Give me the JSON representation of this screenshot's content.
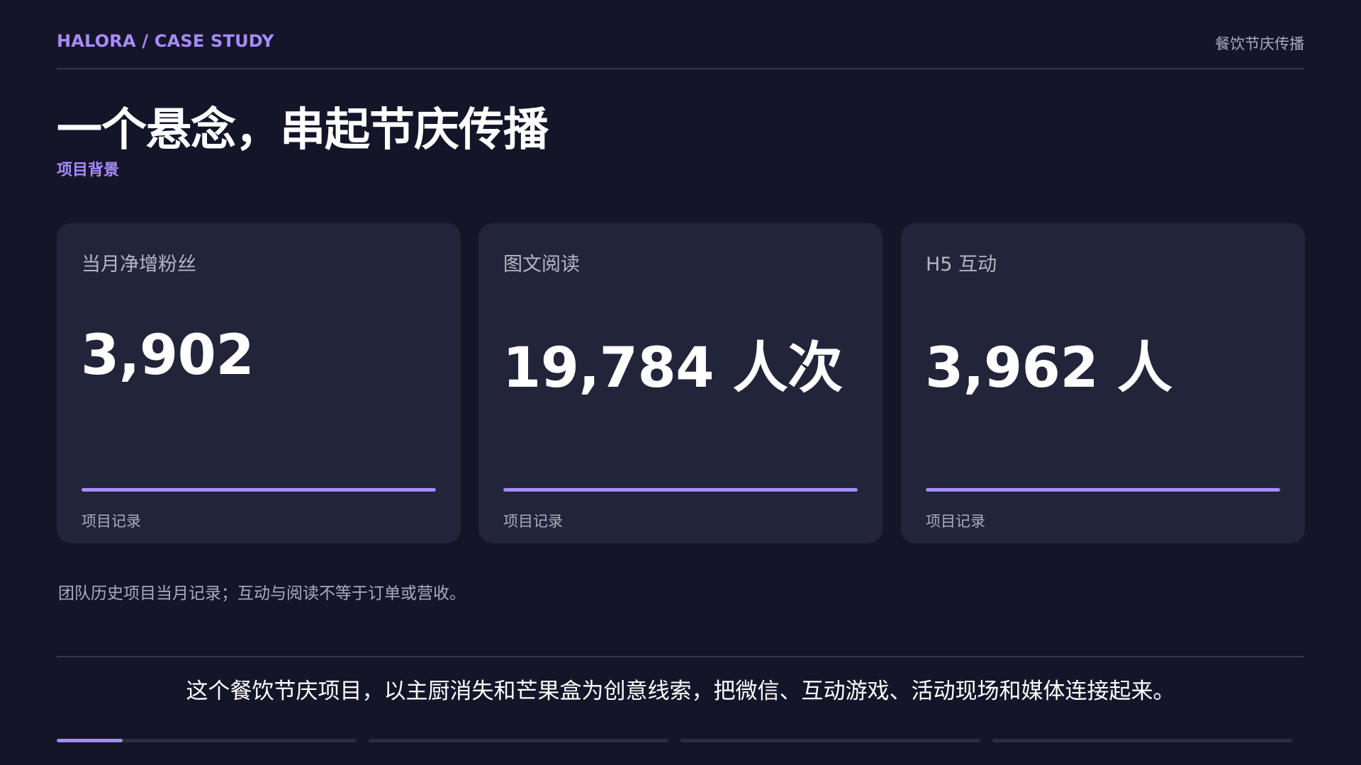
{
  "header": {
    "brand": "HALORA / CASE STUDY",
    "topic": "餐饮节庆传播"
  },
  "hero": {
    "title": "一个悬念，串起节庆传播",
    "subtitle": "项目背景"
  },
  "metrics": [
    {
      "label": "当月净增粉丝",
      "value": "3,902",
      "note": "项目记录",
      "bar_fill": 1.0
    },
    {
      "label": "图文阅读",
      "value": "19,784 人次",
      "note": "项目记录",
      "bar_fill": 1.0
    },
    {
      "label": "H5 互动",
      "value": "3,962 人",
      "note": "项目记录",
      "bar_fill": 1.0
    }
  ],
  "footnote": "团队历史项目当月记录；互动与阅读不等于订单或营收。",
  "summary": "这个餐饮节庆项目，以主厨消失和芒果盒为创意线索，把微信、互动游戏、活动现场和媒体连接起来。",
  "progress": {
    "segments": [
      0.22,
      0,
      0,
      0
    ]
  },
  "colors": {
    "background": "#141529",
    "card": "#22253a",
    "accent": "#a78bfa",
    "muted_text": "#a9abbe"
  }
}
